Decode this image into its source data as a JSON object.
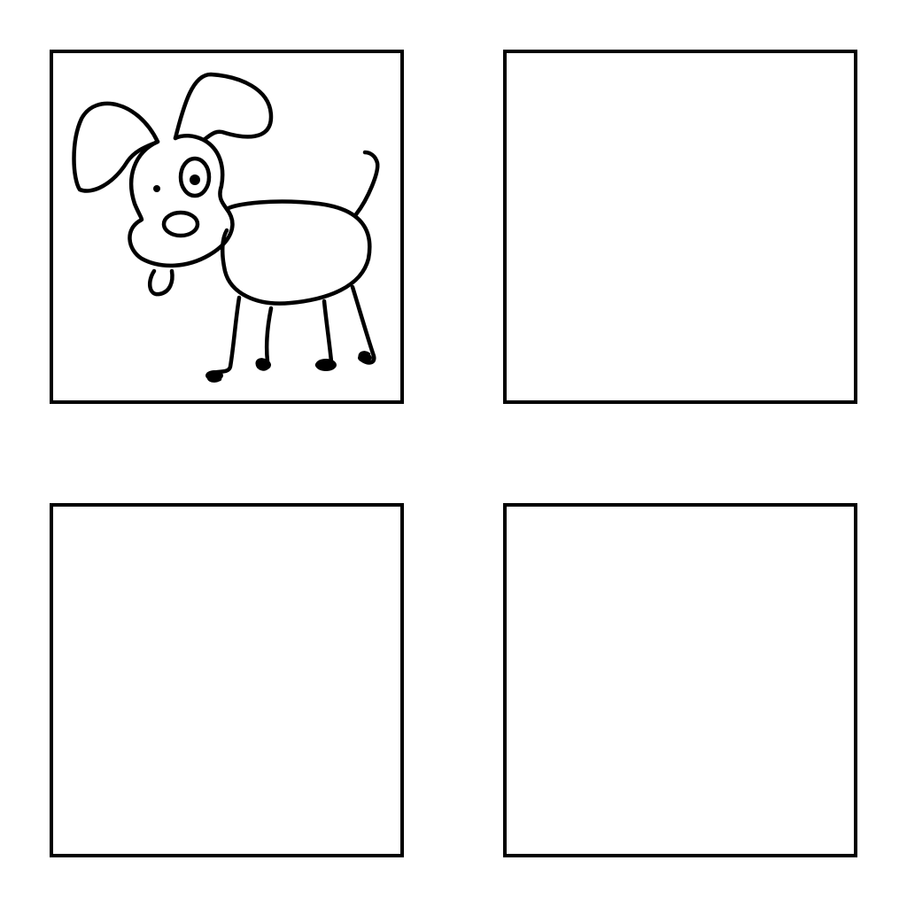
{
  "canvas": {
    "background": "#ffffff",
    "border_color": "#000000"
  },
  "grid": {
    "rows": 2,
    "columns": 2,
    "panels": [
      {
        "content": "cartoon-dog-drawing",
        "filled": true
      },
      {
        "content": "empty",
        "filled": false
      },
      {
        "content": "empty",
        "filled": false
      },
      {
        "content": "empty",
        "filled": false
      }
    ]
  }
}
